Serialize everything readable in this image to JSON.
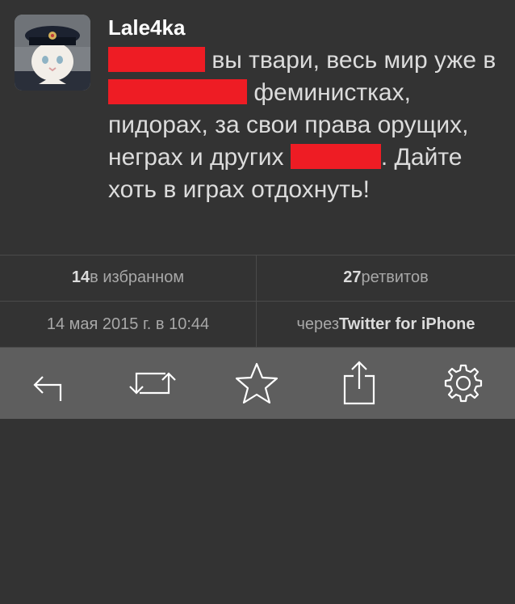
{
  "tweet": {
    "username": "Lale4ka",
    "text": {
      "part1": " вы твари, весь мир уже в ",
      "part2": " феминистках, пидорах, за свои права орущих, неграх и других ",
      "part3": ". Дайте хоть в играх отдохнуть!"
    },
    "redaction_color": "#ee1c24"
  },
  "stats": {
    "favorites_count": "14",
    "favorites_label": " в избранном",
    "retweets_count": "27",
    "retweets_label": " ретвитов",
    "date": "14 мая 2015 г. в 10:44",
    "via_label": "через ",
    "via_client": "Twitter for iPhone"
  },
  "toolbar": {
    "icons": [
      "reply-icon",
      "retweet-icon",
      "favorite-star-icon",
      "share-icon",
      "settings-gear-icon"
    ]
  },
  "colors": {
    "background": "#333333",
    "toolbar": "#5e5e5e",
    "divider": "#4a4a4a"
  }
}
